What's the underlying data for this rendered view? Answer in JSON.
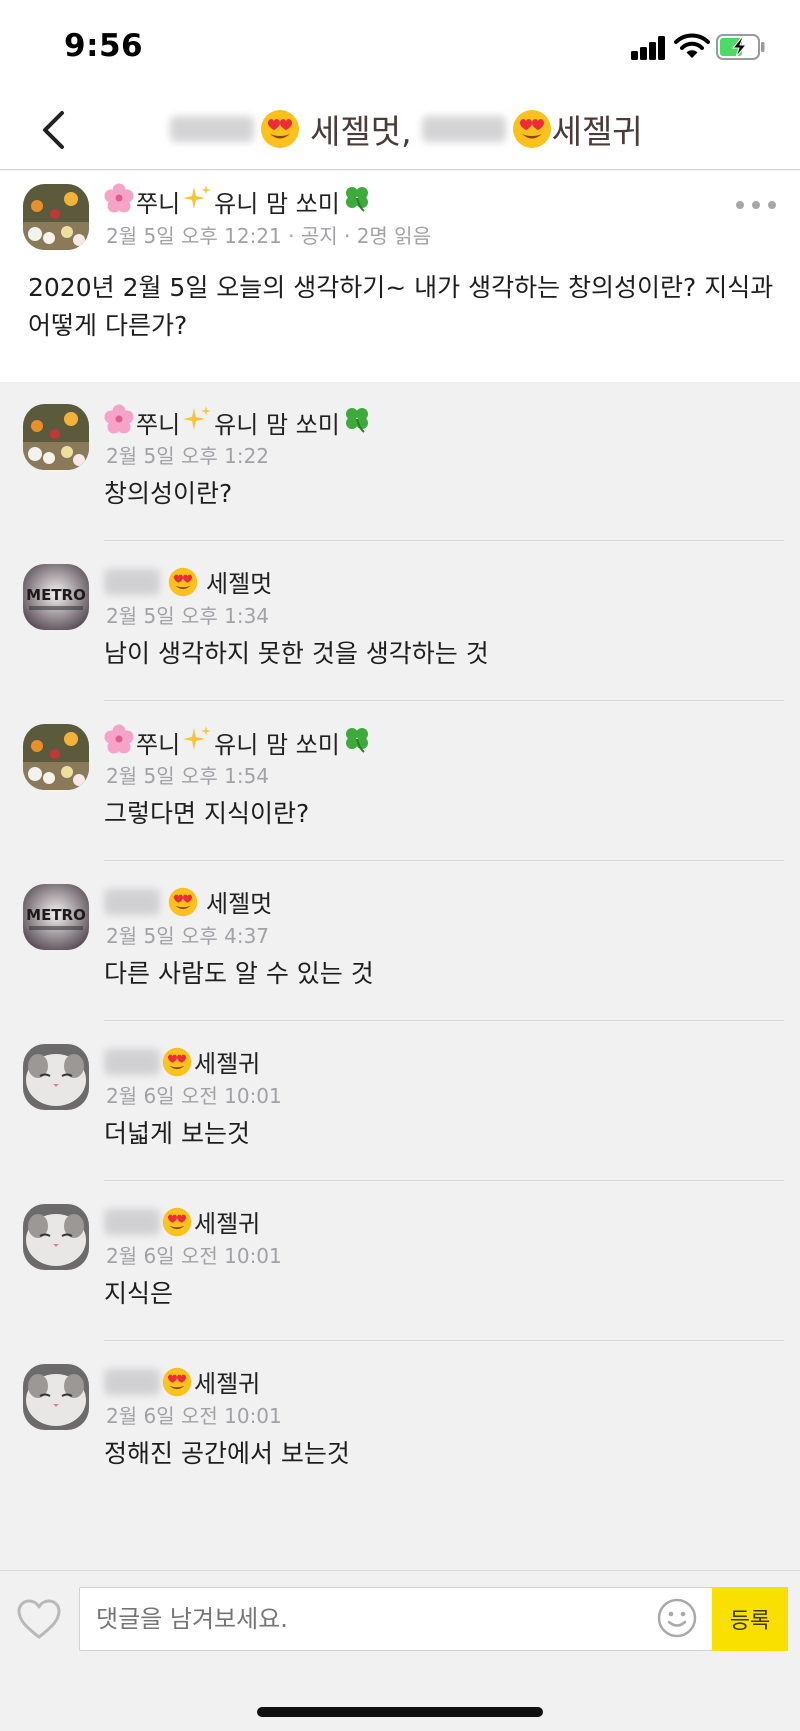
{
  "status_bar": {
    "time": "9:56"
  },
  "nav": {
    "title_part1": "세젤멋,",
    "title_part2": "세젤귀"
  },
  "post": {
    "author": "쭈니",
    "author_suffix": "유니 맘 쏘미",
    "meta": "2월 5일 오후 12:21 · 공지 · 2명 읽음",
    "body": "2020년 2월 5일 오늘의 생각하기~ 내가 생각하는 창의성이란? 지식과 어떻게 다른가?"
  },
  "comments": [
    {
      "avatar": "flowers",
      "author_type": "jjuni",
      "author": "쭈니",
      "author_suffix": "유니 맘 쏘미",
      "meta": "2월 5일 오후 1:22",
      "text": "창의성이란?"
    },
    {
      "avatar": "metro",
      "author_type": "sejelmeot",
      "author": "세젤멋",
      "meta": "2월 5일 오후 1:34",
      "text": "남이 생각하지 못한 것을 생각하는 것"
    },
    {
      "avatar": "flowers",
      "author_type": "jjuni",
      "author": "쭈니",
      "author_suffix": "유니 맘 쏘미",
      "meta": "2월 5일 오후 1:54",
      "text": "그렇다면 지식이란?"
    },
    {
      "avatar": "metro",
      "author_type": "sejelmeot",
      "author": "세젤멋",
      "meta": "2월 5일 오후 4:37",
      "text": "다른 사람도 알 수 있는 것"
    },
    {
      "avatar": "cat",
      "author_type": "sejelgwi",
      "author": "세젤귀",
      "meta": "2월 6일 오전 10:01",
      "text": "더넓게 보는것"
    },
    {
      "avatar": "cat",
      "author_type": "sejelgwi",
      "author": "세젤귀",
      "meta": "2월 6일 오전 10:01",
      "text": "지식은"
    },
    {
      "avatar": "cat",
      "author_type": "sejelgwi",
      "author": "세젤귀",
      "meta": "2월 6일 오전 10:01",
      "text": "정해진 공간에서 보는것"
    }
  ],
  "avatar_logo_text": "METRO",
  "input": {
    "placeholder": "댓글을 남겨보세요."
  },
  "submit_label": "등록",
  "colors": {
    "accent_yellow": "#f9e000",
    "meta_gray": "#a2a2a6",
    "background": "#f1f1f2"
  }
}
